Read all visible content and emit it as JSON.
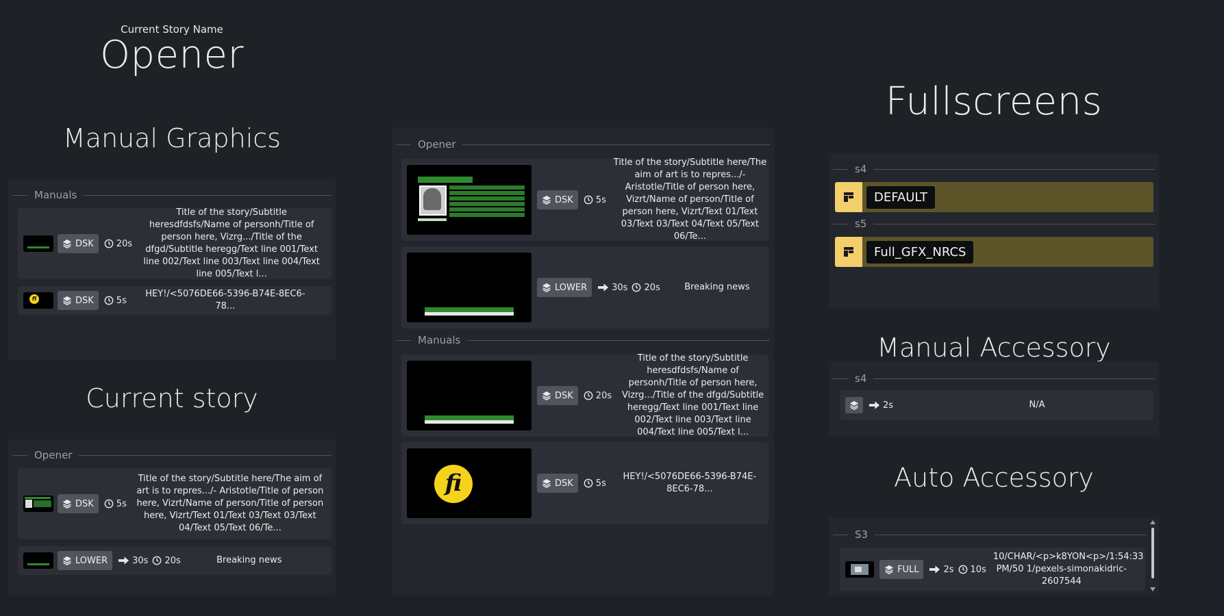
{
  "current_story_name": {
    "caption": "Current Story Name",
    "value": "Opener"
  },
  "manual_graphics": {
    "title": "Manual Graphics",
    "group": "Manuals",
    "items": [
      {
        "tag": "DSK",
        "duration": "20s",
        "text": "Title of the story/Subtitle heresdfdsfs/Name of personh/Title of person here, Vizrg.../Title of the dfgd/Subtitle heregg/Text line 001/Text line 002/Text line 003/Text line 004/Text line 005/Text l...",
        "thumb": "green-lower"
      },
      {
        "tag": "DSK",
        "duration": "5s",
        "text": "HEY!/<5076DE66-5396-B74E-8EC6-78...",
        "thumb": "logo"
      }
    ]
  },
  "current_story": {
    "title": "Current story",
    "group": "Opener",
    "items": [
      {
        "tag": "DSK",
        "duration": "5s",
        "text": "Title of the story/Subtitle here/The aim of art is to repres.../- Aristotle/Title of person here, Vizrt/Name of person/Title of person here, Vizrt/Text 01/Text 03/Text 03/Text 04/Text 05/Text 06/Te...",
        "thumb": "portrait"
      },
      {
        "tag": "LOWER",
        "transition": "30s",
        "duration": "20s",
        "text": "Breaking news",
        "thumb": "green-lower"
      }
    ]
  },
  "center": {
    "groups": [
      {
        "name": "Opener",
        "items": [
          {
            "tag": "DSK",
            "duration": "5s",
            "text": "Title of the story/Subtitle here/The aim of art is to repres.../- Aristotle/Title of person here, Vizrt/Name of person/Title of person here, Vizrt/Text 01/Text 03/Text 03/Text 04/Text 05/Text 06/Te...",
            "thumb": "portrait"
          },
          {
            "tag": "LOWER",
            "transition": "30s",
            "duration": "20s",
            "text": "Breaking news",
            "thumb": "lower-third"
          }
        ]
      },
      {
        "name": "Manuals",
        "items": [
          {
            "tag": "DSK",
            "duration": "20s",
            "text": "Title of the story/Subtitle heresdfdsfs/Name of personh/Title of person here, Vizrg.../Title of the dfgd/Subtitle heregg/Text line 001/Text line 002/Text line 003/Text line 004/Text line 005/Text l...",
            "thumb": "lower-third"
          },
          {
            "tag": "DSK",
            "duration": "5s",
            "text": "HEY!/<5076DE66-5396-B74E-8EC6-78...",
            "thumb": "logo-large",
            "logo_text": "fi"
          }
        ]
      }
    ]
  },
  "fullscreens": {
    "title": "Fullscreens",
    "groups": [
      {
        "name": "s4",
        "item": "DEFAULT"
      },
      {
        "name": "s5",
        "item": "Full_GFX_NRCS"
      }
    ]
  },
  "manual_accessory": {
    "title": "Manual Accessory",
    "group": "s4",
    "item": {
      "transition": "2s",
      "text": "N/A"
    }
  },
  "auto_accessory": {
    "title": "Auto Accessory",
    "group": "S3",
    "item": {
      "tag": "FULL",
      "transition": "2s",
      "duration": "10s",
      "text": "10/CHAR/<p>k8YON<p>/1:54:33 PM/50 1/pexels-simonakidric-2607544"
    }
  },
  "colors": {
    "background": "#1e2126",
    "panel": "#23272d",
    "card": "#2c3036",
    "tag": "#50555c",
    "fullscreen_row": "#5c552a",
    "fullscreen_icon": "#f2cf6b",
    "logo_yellow": "#f5d31c"
  }
}
